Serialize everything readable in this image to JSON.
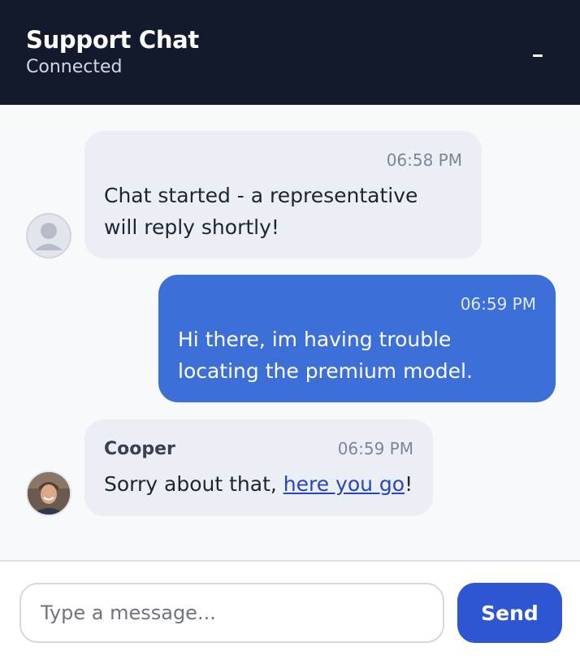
{
  "header": {
    "title": "Support Chat",
    "status": "Connected",
    "minimize_icon": "minimize-icon"
  },
  "messages": [
    {
      "from": "system",
      "time": "06:58 PM",
      "lines": [
        "Chat started - a representative",
        "will reply shortly!"
      ],
      "avatar_icon": "default-user-avatar-icon"
    },
    {
      "from": "user",
      "time": "06:59 PM",
      "lines": [
        "Hi there, im having trouble",
        "locating the premium model."
      ]
    },
    {
      "from": "agent",
      "sender": "Cooper",
      "time": "06:59 PM",
      "text_before": "Sorry about that, ",
      "link_text": "here you go",
      "text_after": "!",
      "avatar_icon": "agent-photo-avatar"
    }
  ],
  "composer": {
    "placeholder": "Type a message...",
    "value": "",
    "send_label": "Send"
  },
  "colors": {
    "header_bg": "#131a2b",
    "user_bubble": "#3c6fd8",
    "agent_bubble": "#eceef5",
    "send_button": "#2e55d2",
    "link": "#2546c4"
  }
}
